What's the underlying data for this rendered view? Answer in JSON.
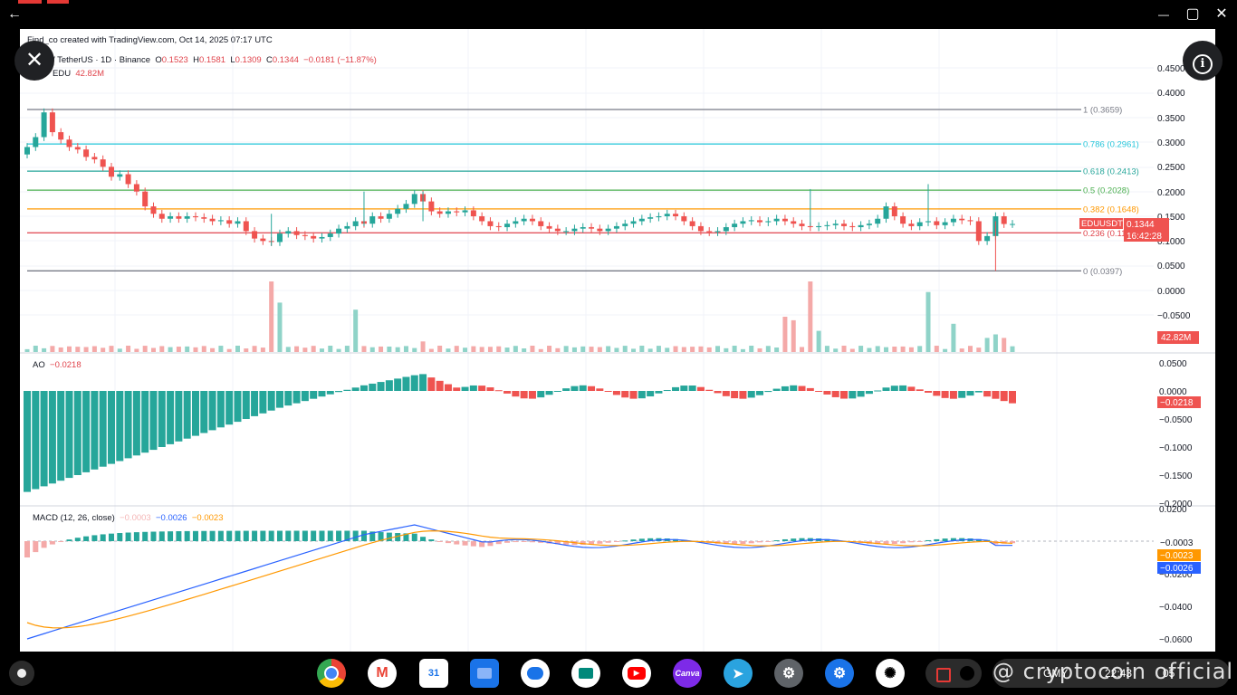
{
  "window": {
    "back_label": "←",
    "minimize_label": "—",
    "maximize_label": "▢",
    "close_label": "✕"
  },
  "overlay": {
    "close_label": "✕",
    "info_label": "i"
  },
  "header": {
    "created": "Find_co created with TradingView.com, Oct 14, 2025 07:17 UTC",
    "symbol": "/ TetherUS · 1D · Binance",
    "o_label": "O",
    "o": "0.1523",
    "h_label": "H",
    "h": "0.1581",
    "l_label": "L",
    "l": "0.1309",
    "c_label": "C",
    "c": "0.1344",
    "change": "−0.0181 (−11.87%)",
    "vol_label": "EDU",
    "vol_value": "42.82M"
  },
  "price_axis": [
    "0.4500",
    "0.4000",
    "0.3500",
    "0.3000",
    "0.2500",
    "0.2000",
    "0.1500",
    "0.1000",
    "0.0500",
    "0.0000",
    "−0.0500"
  ],
  "fib_levels": [
    {
      "label": "1 (0.3659)",
      "value": 0.3659,
      "color": "#787b86"
    },
    {
      "label": "0.786 (0.2961)",
      "value": 0.2961,
      "color": "#26c6da"
    },
    {
      "label": "0.618 (0.2413)",
      "value": 0.2413,
      "color": "#26a69a"
    },
    {
      "label": "0.5 (0.2028)",
      "value": 0.2028,
      "color": "#4caf50"
    },
    {
      "label": "0.382 (0.1648)",
      "value": 0.1648,
      "color": "#ff9800"
    },
    {
      "label": "0.236 (0.1166)",
      "value": 0.1166,
      "color": "#e0434b"
    },
    {
      "label": "0 (0.0397)",
      "value": 0.0397,
      "color": "#787b86"
    }
  ],
  "price_badge": {
    "symbol": "EDUUSDT",
    "price": "0.1344",
    "countdown": "16:42:28"
  },
  "volume_badge": "42.82M",
  "ao": {
    "label": "AO",
    "value": "−0.0218",
    "axis": [
      "0.0500",
      "0.0000",
      "−0.0500",
      "−0.1000",
      "−0.1500",
      "−0.2000"
    ],
    "badge": "−0.0218"
  },
  "macd": {
    "label": "MACD (12, 26, close)",
    "hist": "−0.0003",
    "macd": "−0.0026",
    "signal": "−0.0023",
    "axis": [
      "0.0200",
      "0.0000",
      "−0.0200",
      "−0.0400",
      "−0.0600"
    ],
    "badges": [
      "−0.0003",
      "−0.0023",
      "−0.0026"
    ]
  },
  "colors": {
    "up": "#26a69a",
    "down": "#ef5350",
    "macd_line": "#2962ff",
    "signal_line": "#ff9800"
  },
  "taskbar": {
    "apps": [
      "chrome-icon",
      "gmail-icon",
      "calendar-icon",
      "files-icon",
      "messages-icon",
      "meet-icon",
      "youtube-icon",
      "canva-icon",
      "telegram-icon",
      "settings-icon",
      "settings-alt-icon",
      "chatgpt-icon"
    ],
    "calendar_day": "31",
    "canva_label": "Canva",
    "tray_text": "GMY",
    "clock": "22:43",
    "date_text": "05"
  },
  "watermark": "@ cryptocoin official"
}
